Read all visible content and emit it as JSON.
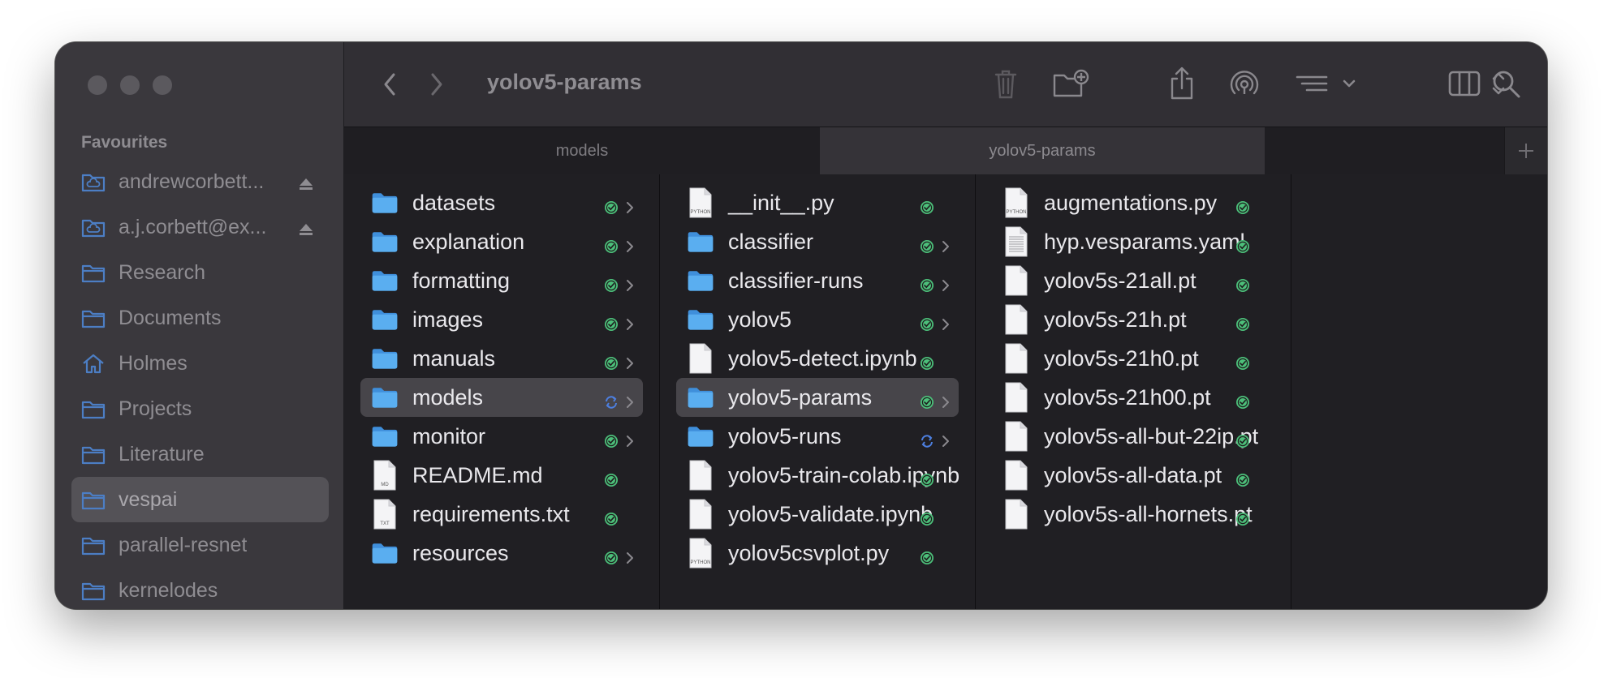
{
  "window": {
    "title": "yolov5-params"
  },
  "sidebar": {
    "heading": "Favourites",
    "items": [
      {
        "label": "andrewcorbett...",
        "icon": "icloud-drive-icon",
        "eject": true
      },
      {
        "label": "a.j.corbett@ex...",
        "icon": "icloud-drive-icon",
        "eject": true
      },
      {
        "label": "Research",
        "icon": "folder-icon"
      },
      {
        "label": "Documents",
        "icon": "folder-icon"
      },
      {
        "label": "Holmes",
        "icon": "home-icon"
      },
      {
        "label": "Projects",
        "icon": "folder-icon"
      },
      {
        "label": "Literature",
        "icon": "folder-icon"
      },
      {
        "label": "vespai",
        "icon": "folder-icon",
        "selected": true
      },
      {
        "label": "parallel-resnet",
        "icon": "folder-icon"
      },
      {
        "label": "kernelodes",
        "icon": "folder-icon"
      }
    ]
  },
  "tabs": [
    {
      "label": "models",
      "active": false
    },
    {
      "label": "yolov5-params",
      "active": true
    }
  ],
  "columns": [
    {
      "items": [
        {
          "name": "datasets",
          "kind": "folder",
          "status": "synced"
        },
        {
          "name": "explanation",
          "kind": "folder",
          "status": "synced"
        },
        {
          "name": "formatting",
          "kind": "folder",
          "status": "synced"
        },
        {
          "name": "images",
          "kind": "folder",
          "status": "synced"
        },
        {
          "name": "manuals",
          "kind": "folder",
          "status": "synced"
        },
        {
          "name": "models",
          "kind": "folder",
          "status": "syncing",
          "selected": true
        },
        {
          "name": "monitor",
          "kind": "folder",
          "status": "synced"
        },
        {
          "name": "README.md",
          "kind": "file",
          "badge": "MD",
          "status": "synced"
        },
        {
          "name": "requirements.txt",
          "kind": "file",
          "badge": "TXT",
          "status": "synced"
        },
        {
          "name": "resources",
          "kind": "folder",
          "status": "synced"
        }
      ]
    },
    {
      "items": [
        {
          "name": "__init__.py",
          "kind": "file",
          "badge": "PYTHON",
          "status": "synced"
        },
        {
          "name": "classifier",
          "kind": "folder",
          "status": "synced"
        },
        {
          "name": "classifier-runs",
          "kind": "folder",
          "status": "synced"
        },
        {
          "name": "yolov5",
          "kind": "folder",
          "status": "synced"
        },
        {
          "name": "yolov5-detect.ipynb",
          "kind": "file",
          "status": "synced"
        },
        {
          "name": "yolov5-params",
          "kind": "folder",
          "status": "synced",
          "selected": true
        },
        {
          "name": "yolov5-runs",
          "kind": "folder",
          "status": "syncing"
        },
        {
          "name": "yolov5-train-colab.ipynb",
          "kind": "file",
          "status": "synced"
        },
        {
          "name": "yolov5-validate.ipynb",
          "kind": "file",
          "status": "synced"
        },
        {
          "name": "yolov5csvplot.py",
          "kind": "file",
          "badge": "PYTHON",
          "status": "synced"
        }
      ]
    },
    {
      "items": [
        {
          "name": "augmentations.py",
          "kind": "file",
          "badge": "PYTHON",
          "status": "synced"
        },
        {
          "name": "hyp.vesparams.yaml",
          "kind": "file",
          "lined": true,
          "status": "synced"
        },
        {
          "name": "yolov5s-21all.pt",
          "kind": "file",
          "status": "synced"
        },
        {
          "name": "yolov5s-21h.pt",
          "kind": "file",
          "status": "synced"
        },
        {
          "name": "yolov5s-21h0.pt",
          "kind": "file",
          "status": "synced"
        },
        {
          "name": "yolov5s-21h00.pt",
          "kind": "file",
          "status": "synced"
        },
        {
          "name": "yolov5s-all-but-22ip.pt",
          "kind": "file",
          "status": "synced"
        },
        {
          "name": "yolov5s-all-data.pt",
          "kind": "file",
          "status": "synced"
        },
        {
          "name": "yolov5s-all-hornets.pt",
          "kind": "file",
          "status": "synced"
        }
      ]
    }
  ],
  "colors": {
    "folder": "#5aaef0",
    "synced": "#4cbf7a",
    "syncing": "#4d7fe0"
  }
}
